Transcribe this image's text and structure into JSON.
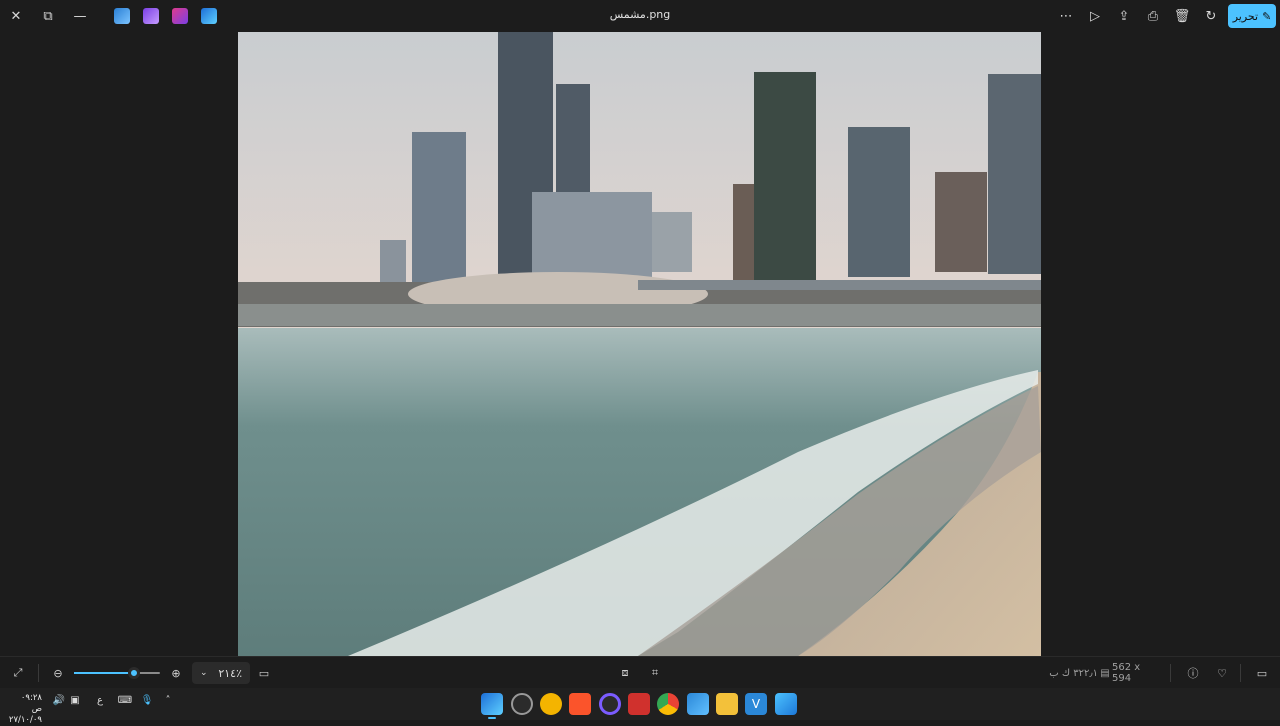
{
  "titlebar": {
    "title": "مشمس.png",
    "edit_label": "تحرير",
    "buttons": [
      "close-icon",
      "restore-icon",
      "minimize-icon",
      "onedrive-icon",
      "video-editor-icon",
      "designer-icon",
      "photos-icon",
      "more-icon",
      "slideshow-icon",
      "share-icon",
      "print-icon",
      "delete-icon",
      "rotate-icon",
      "edit-icon"
    ]
  },
  "bottombar": {
    "zoom_value": "٢١٤٪",
    "zoom_fraction": 0.7,
    "dimensions": "562 x 594",
    "file_size": "٣٢٢٫١ ك ب"
  },
  "taskbar": {
    "clock_time": "٠٩:٢٨ ص",
    "clock_date": "٢٧/١٠/٠٩",
    "lang": "ع",
    "apps": [
      "photos-icon",
      "clock-icon",
      "weather-icon",
      "brave-icon",
      "cortana-icon",
      "media-icon",
      "chrome-icon",
      "store-icon",
      "file-explorer-icon",
      "vscode-icon",
      "start-icon"
    ]
  },
  "colors": {
    "accent": "#4cc2ff",
    "background": "#1c1c1c"
  }
}
